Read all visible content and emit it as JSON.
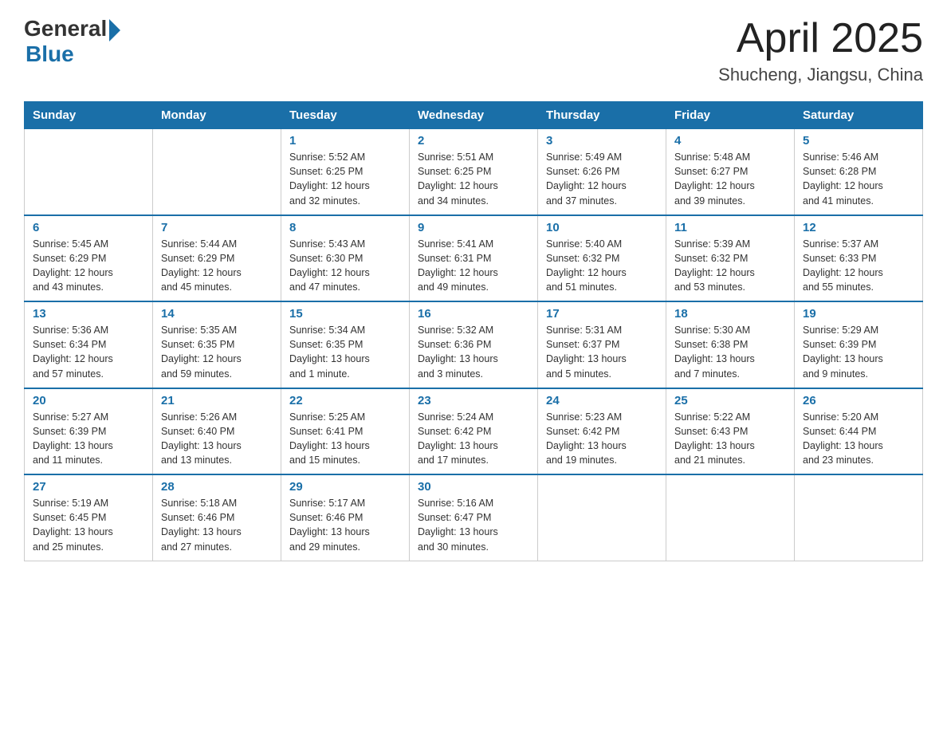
{
  "header": {
    "logo_general": "General",
    "logo_blue": "Blue",
    "month_year": "April 2025",
    "location": "Shucheng, Jiangsu, China"
  },
  "days_of_week": [
    "Sunday",
    "Monday",
    "Tuesday",
    "Wednesday",
    "Thursday",
    "Friday",
    "Saturday"
  ],
  "weeks": [
    [
      {
        "day": "",
        "info": ""
      },
      {
        "day": "",
        "info": ""
      },
      {
        "day": "1",
        "info": "Sunrise: 5:52 AM\nSunset: 6:25 PM\nDaylight: 12 hours\nand 32 minutes."
      },
      {
        "day": "2",
        "info": "Sunrise: 5:51 AM\nSunset: 6:25 PM\nDaylight: 12 hours\nand 34 minutes."
      },
      {
        "day": "3",
        "info": "Sunrise: 5:49 AM\nSunset: 6:26 PM\nDaylight: 12 hours\nand 37 minutes."
      },
      {
        "day": "4",
        "info": "Sunrise: 5:48 AM\nSunset: 6:27 PM\nDaylight: 12 hours\nand 39 minutes."
      },
      {
        "day": "5",
        "info": "Sunrise: 5:46 AM\nSunset: 6:28 PM\nDaylight: 12 hours\nand 41 minutes."
      }
    ],
    [
      {
        "day": "6",
        "info": "Sunrise: 5:45 AM\nSunset: 6:29 PM\nDaylight: 12 hours\nand 43 minutes."
      },
      {
        "day": "7",
        "info": "Sunrise: 5:44 AM\nSunset: 6:29 PM\nDaylight: 12 hours\nand 45 minutes."
      },
      {
        "day": "8",
        "info": "Sunrise: 5:43 AM\nSunset: 6:30 PM\nDaylight: 12 hours\nand 47 minutes."
      },
      {
        "day": "9",
        "info": "Sunrise: 5:41 AM\nSunset: 6:31 PM\nDaylight: 12 hours\nand 49 minutes."
      },
      {
        "day": "10",
        "info": "Sunrise: 5:40 AM\nSunset: 6:32 PM\nDaylight: 12 hours\nand 51 minutes."
      },
      {
        "day": "11",
        "info": "Sunrise: 5:39 AM\nSunset: 6:32 PM\nDaylight: 12 hours\nand 53 minutes."
      },
      {
        "day": "12",
        "info": "Sunrise: 5:37 AM\nSunset: 6:33 PM\nDaylight: 12 hours\nand 55 minutes."
      }
    ],
    [
      {
        "day": "13",
        "info": "Sunrise: 5:36 AM\nSunset: 6:34 PM\nDaylight: 12 hours\nand 57 minutes."
      },
      {
        "day": "14",
        "info": "Sunrise: 5:35 AM\nSunset: 6:35 PM\nDaylight: 12 hours\nand 59 minutes."
      },
      {
        "day": "15",
        "info": "Sunrise: 5:34 AM\nSunset: 6:35 PM\nDaylight: 13 hours\nand 1 minute."
      },
      {
        "day": "16",
        "info": "Sunrise: 5:32 AM\nSunset: 6:36 PM\nDaylight: 13 hours\nand 3 minutes."
      },
      {
        "day": "17",
        "info": "Sunrise: 5:31 AM\nSunset: 6:37 PM\nDaylight: 13 hours\nand 5 minutes."
      },
      {
        "day": "18",
        "info": "Sunrise: 5:30 AM\nSunset: 6:38 PM\nDaylight: 13 hours\nand 7 minutes."
      },
      {
        "day": "19",
        "info": "Sunrise: 5:29 AM\nSunset: 6:39 PM\nDaylight: 13 hours\nand 9 minutes."
      }
    ],
    [
      {
        "day": "20",
        "info": "Sunrise: 5:27 AM\nSunset: 6:39 PM\nDaylight: 13 hours\nand 11 minutes."
      },
      {
        "day": "21",
        "info": "Sunrise: 5:26 AM\nSunset: 6:40 PM\nDaylight: 13 hours\nand 13 minutes."
      },
      {
        "day": "22",
        "info": "Sunrise: 5:25 AM\nSunset: 6:41 PM\nDaylight: 13 hours\nand 15 minutes."
      },
      {
        "day": "23",
        "info": "Sunrise: 5:24 AM\nSunset: 6:42 PM\nDaylight: 13 hours\nand 17 minutes."
      },
      {
        "day": "24",
        "info": "Sunrise: 5:23 AM\nSunset: 6:42 PM\nDaylight: 13 hours\nand 19 minutes."
      },
      {
        "day": "25",
        "info": "Sunrise: 5:22 AM\nSunset: 6:43 PM\nDaylight: 13 hours\nand 21 minutes."
      },
      {
        "day": "26",
        "info": "Sunrise: 5:20 AM\nSunset: 6:44 PM\nDaylight: 13 hours\nand 23 minutes."
      }
    ],
    [
      {
        "day": "27",
        "info": "Sunrise: 5:19 AM\nSunset: 6:45 PM\nDaylight: 13 hours\nand 25 minutes."
      },
      {
        "day": "28",
        "info": "Sunrise: 5:18 AM\nSunset: 6:46 PM\nDaylight: 13 hours\nand 27 minutes."
      },
      {
        "day": "29",
        "info": "Sunrise: 5:17 AM\nSunset: 6:46 PM\nDaylight: 13 hours\nand 29 minutes."
      },
      {
        "day": "30",
        "info": "Sunrise: 5:16 AM\nSunset: 6:47 PM\nDaylight: 13 hours\nand 30 minutes."
      },
      {
        "day": "",
        "info": ""
      },
      {
        "day": "",
        "info": ""
      },
      {
        "day": "",
        "info": ""
      }
    ]
  ]
}
